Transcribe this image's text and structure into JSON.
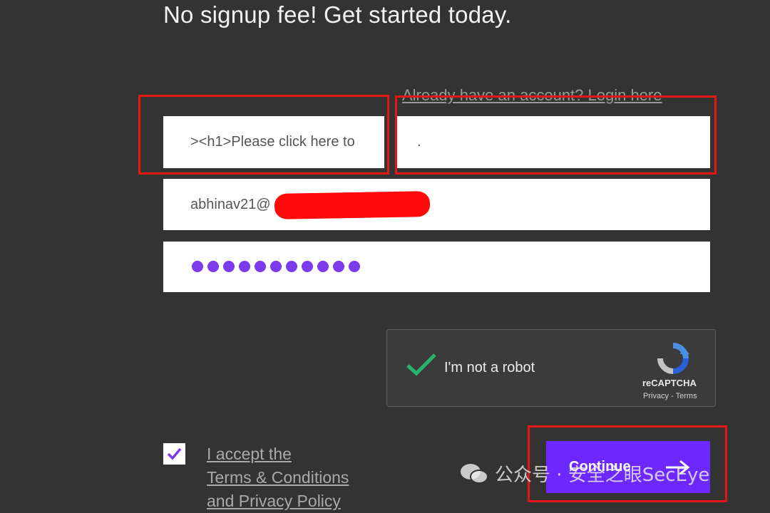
{
  "header": {
    "title": "No signup fee! Get started today.",
    "login_link": "Already have an account? Login here"
  },
  "form": {
    "first_name_value": "><h1>Please click here to",
    "last_name_value": ".",
    "email_value": "abhinav21@",
    "password_mask_length": 11,
    "captcha": {
      "label": "I'm not a robot",
      "brand": "reCAPTCHA",
      "links": "Privacy - Terms",
      "checked": true
    },
    "terms": {
      "checked": true,
      "line1": "I accept the",
      "line2": "Terms & Conditions",
      "line3": "and Privacy Policy"
    },
    "continue_label": "Continue"
  },
  "watermark": {
    "text": "公众号 · 安全之眼SecEye"
  },
  "colors": {
    "background": "#333333",
    "accent_purple": "#6d28ff",
    "password_dot": "#7c3aed",
    "highlight_red": "#e41616",
    "check_green": "#28b46a"
  }
}
